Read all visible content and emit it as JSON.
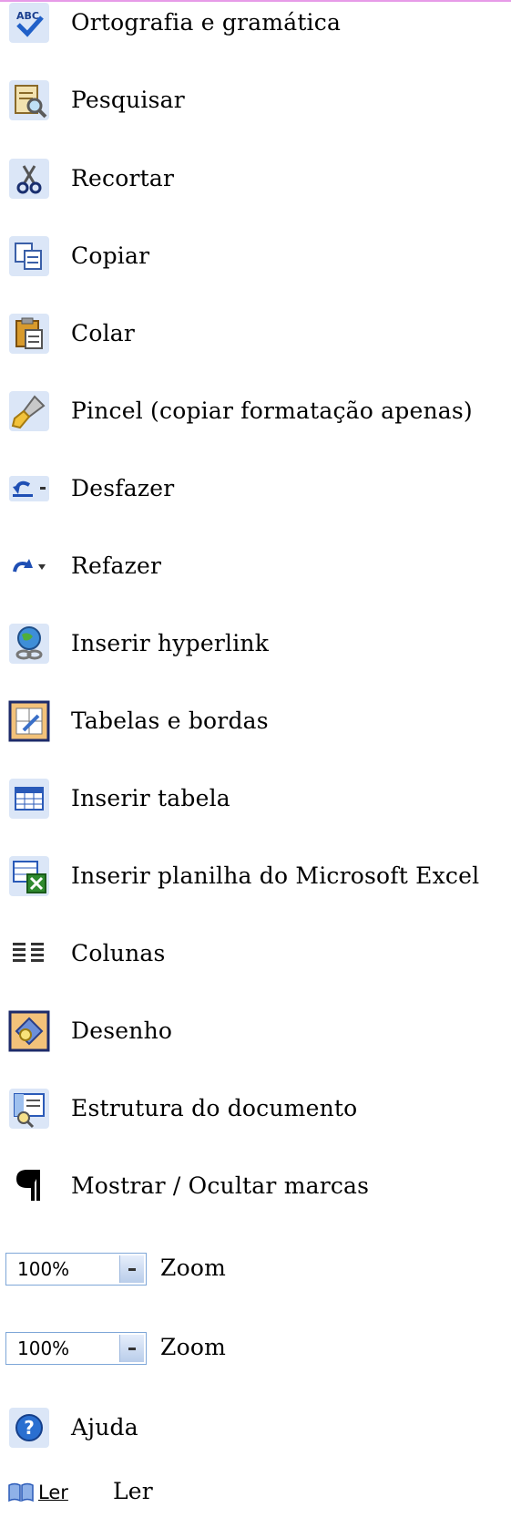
{
  "items": [
    {
      "label": "Ortografia e gramática",
      "icon": "spelling-icon"
    },
    {
      "label": "Pesquisar",
      "icon": "research-icon"
    },
    {
      "label": "Recortar",
      "icon": "scissors-icon"
    },
    {
      "label": "Copiar",
      "icon": "copy-icon"
    },
    {
      "label": "Colar",
      "icon": "paste-icon"
    },
    {
      "label": "Pincel (copiar formatação apenas)",
      "icon": "format-painter-icon"
    },
    {
      "label": "Desfazer",
      "icon": "undo-icon"
    },
    {
      "label": "Refazer",
      "icon": "redo-icon"
    },
    {
      "label": "Inserir hyperlink",
      "icon": "hyperlink-icon"
    },
    {
      "label": "Tabelas e bordas",
      "icon": "tables-borders-icon"
    },
    {
      "label": "Inserir tabela",
      "icon": "insert-table-icon"
    },
    {
      "label": "Inserir planilha do Microsoft Excel",
      "icon": "excel-sheet-icon"
    },
    {
      "label": "Colunas",
      "icon": "columns-icon"
    },
    {
      "label": "Desenho",
      "icon": "drawing-icon"
    },
    {
      "label": "Estrutura do documento",
      "icon": "document-map-icon"
    },
    {
      "label": "Mostrar / Ocultar marcas",
      "icon": "pilcrow-icon"
    }
  ],
  "zoom": [
    {
      "value": "100%",
      "label": "Zoom"
    },
    {
      "value": "100%",
      "label": "Zoom"
    }
  ],
  "help": {
    "label": "Ajuda",
    "icon": "help-icon"
  },
  "read": {
    "button_text": "Ler",
    "label": "Ler",
    "icon": "book-icon"
  }
}
